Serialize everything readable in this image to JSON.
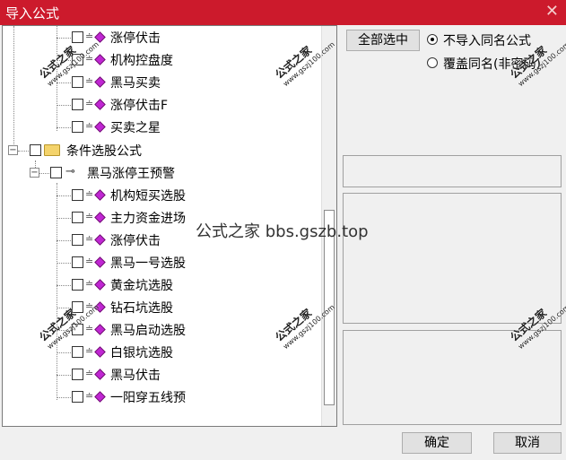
{
  "window": {
    "title": "导入公式",
    "close_glyph": "✕"
  },
  "tree": {
    "items_top": [
      "涨停伏击",
      "机构控盘度",
      "黑马买卖",
      "涨停伏击F",
      "买卖之星"
    ],
    "group_label": "条件选股公式",
    "subgroup_label": "黑马涨停王预警",
    "items_bottom": [
      "机构短买选股",
      "主力资金进场",
      "涨停伏击",
      "黑马一号选股",
      "黄金坑选股",
      "钻石坑选股",
      "黑马启动选股",
      "白银坑选股",
      "黑马伏击",
      "一阳穿五线预"
    ]
  },
  "right": {
    "select_all_label": "全部选中",
    "option_no_import": "不导入同名公式",
    "option_overwrite": "覆盖同名(非密码)"
  },
  "footer": {
    "ok_label": "确定",
    "cancel_label": "取消"
  },
  "watermark": {
    "brand": "公式之家",
    "url": "www.gszj100.com",
    "center": "公式之家 bbs.gszb.top"
  },
  "colors": {
    "titlebar": "#cc1a2c",
    "item_icon": "#c026d3"
  }
}
